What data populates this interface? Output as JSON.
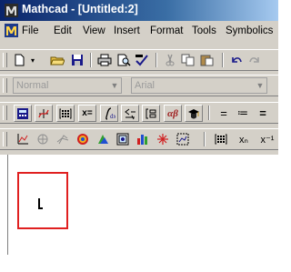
{
  "window": {
    "title": "Mathcad - [Untitled:2]"
  },
  "menu": {
    "items": [
      "File",
      "Edit",
      "View",
      "Insert",
      "Format",
      "Tools",
      "Symbolics"
    ]
  },
  "format_toolbar": {
    "style_value": "Normal",
    "font_value": "Arial"
  },
  "math_toolbar": {
    "buttons": [
      "calculator-icon",
      "graph-icon",
      "matrix-icon",
      "evaluation-icon",
      "calculus-icon",
      "boolean-icon",
      "programming-icon",
      "greek-icon",
      "symbolic-icon"
    ],
    "labels": {
      "evaluation": "x=",
      "greek": "αβ"
    }
  },
  "graph_toolbar": {
    "buttons": [
      "xy-plot-icon",
      "polar-plot-icon",
      "surface-plot-icon",
      "contour-plot-icon",
      "3d-scatter-icon",
      "3d-bar-icon",
      "vector-field-icon",
      "plot-wizard-icon",
      "insert-matrix-icon",
      "subscript-icon",
      "inverse-icon"
    ],
    "labels": {
      "subscript": "xₙ",
      "inverse": "x⁻¹"
    }
  },
  "colors": {
    "title_bar_start": "#0a246a",
    "title_bar_end": "#a6caf0",
    "chrome": "#d4d0c8",
    "region_border": "#e02020"
  }
}
